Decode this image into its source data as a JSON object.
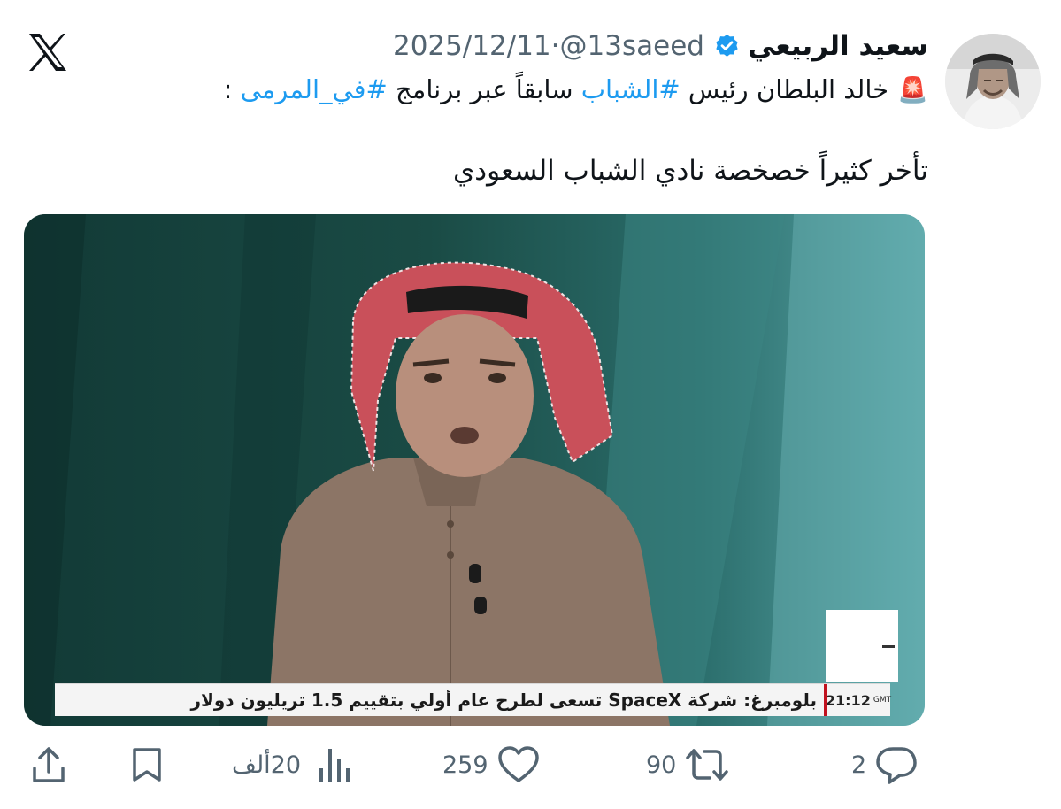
{
  "app": {
    "logo_icon": "x-logo-icon"
  },
  "author": {
    "name": "سعيد الربيعي",
    "handle": "@13saeed",
    "separator": "·",
    "date": "2025/12/11",
    "verified_icon": "verified-badge-icon",
    "verified_color": "#1d9bf0"
  },
  "tweet": {
    "line1": {
      "siren": "🚨",
      "p1": "خالد البلطان رئيس ",
      "tag1": "#الشباب",
      "p2": " سابقاً عبر برنامج ",
      "tag2": "#في_المرمى",
      "p3": " :"
    },
    "line2": "تأخر كثيراً خصخصة نادي الشباب السعودي"
  },
  "media": {
    "ticker": {
      "time": "21:12",
      "zone": "GMT",
      "text": "بلومبرغ: شركة SpaceX تسعى لطرح عام أولي بتقييم 1.5 تريليون دولار"
    }
  },
  "actions": {
    "replies": "2",
    "retweets": "90",
    "likes": "259",
    "views": "20ألف",
    "reply_icon": "reply-icon",
    "retweet_icon": "retweet-icon",
    "like_icon": "heart-icon",
    "views_icon": "views-chart-icon",
    "bookmark_icon": "bookmark-icon",
    "share_icon": "share-icon"
  },
  "colors": {
    "link": "#1d9bf0",
    "secondary_text": "#536471",
    "text": "#0f1419"
  }
}
